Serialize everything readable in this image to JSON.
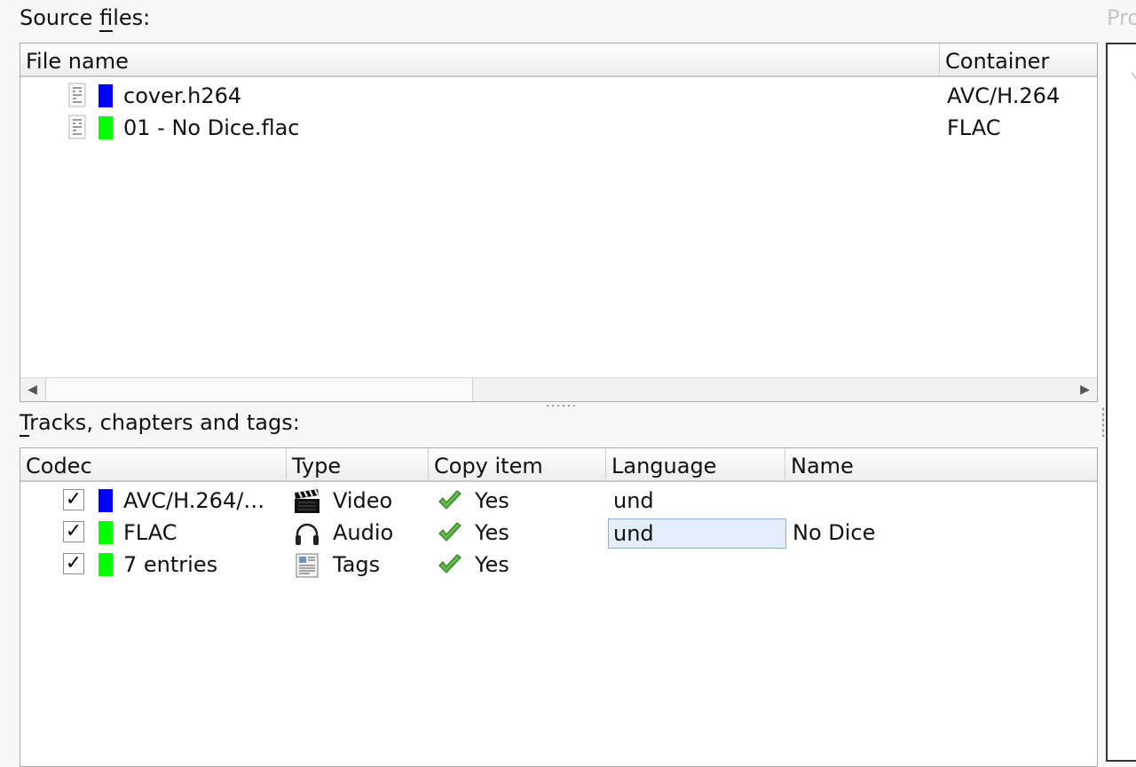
{
  "source_files": {
    "label_pre": "Source ",
    "label_key": "f",
    "label_post": "iles:",
    "columns": [
      "File name",
      "Container"
    ],
    "rows": [
      {
        "name": "cover.h264",
        "container": "AVC/H.264",
        "color": "#0000ff"
      },
      {
        "name": "01 - No Dice.flac",
        "container": "FLAC",
        "color": "#00ff00"
      }
    ]
  },
  "tracks": {
    "label_key": "T",
    "label_post": "racks, chapters and tags:",
    "columns": [
      "Codec",
      "Type",
      "Copy item",
      "Language",
      "Name"
    ],
    "rows": [
      {
        "checked": "✓",
        "color": "#0000ff",
        "codec": "AVC/H.264/…",
        "type": "Video",
        "type_icon": "clapperboard-icon",
        "copy": "Yes",
        "language": "und",
        "name": ""
      },
      {
        "checked": "✓",
        "color": "#00ff00",
        "codec": "FLAC",
        "type": "Audio",
        "type_icon": "headphones-icon",
        "copy": "Yes",
        "language": "und",
        "name": "No Dice"
      },
      {
        "checked": "✓",
        "color": "#00ff00",
        "codec": "7 entries",
        "type": "Tags",
        "type_icon": "document-icon",
        "copy": "Yes",
        "language": "",
        "name": ""
      }
    ]
  },
  "right_panel": {
    "label": "Pro"
  }
}
